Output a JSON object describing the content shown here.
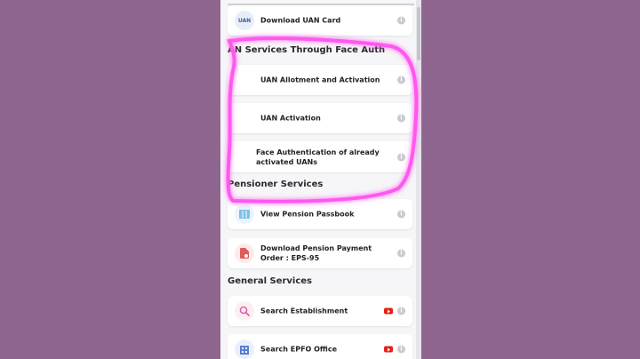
{
  "cards": {
    "download_uan": "Download UAN Card",
    "uan_allotment": "UAN Allotment and Activation",
    "uan_activation": "UAN Activation",
    "face_auth": "Face Authentication of already activated UANs",
    "pension_passbook": "View Pension Passbook",
    "pension_order": "Download Pension Payment Order : EPS-95",
    "search_establishment": "Search Establishment",
    "search_office": "Search EPFO Office"
  },
  "sections": {
    "face_auth": "AN Services Through Face Auth",
    "pensioner": "Pensioner Services",
    "general": "General Services"
  },
  "icons": {
    "uan": "UAN",
    "info": "i"
  },
  "colors": {
    "background": "#8e6690",
    "highlight": "#ff4df0",
    "youtube": "#e62117"
  }
}
